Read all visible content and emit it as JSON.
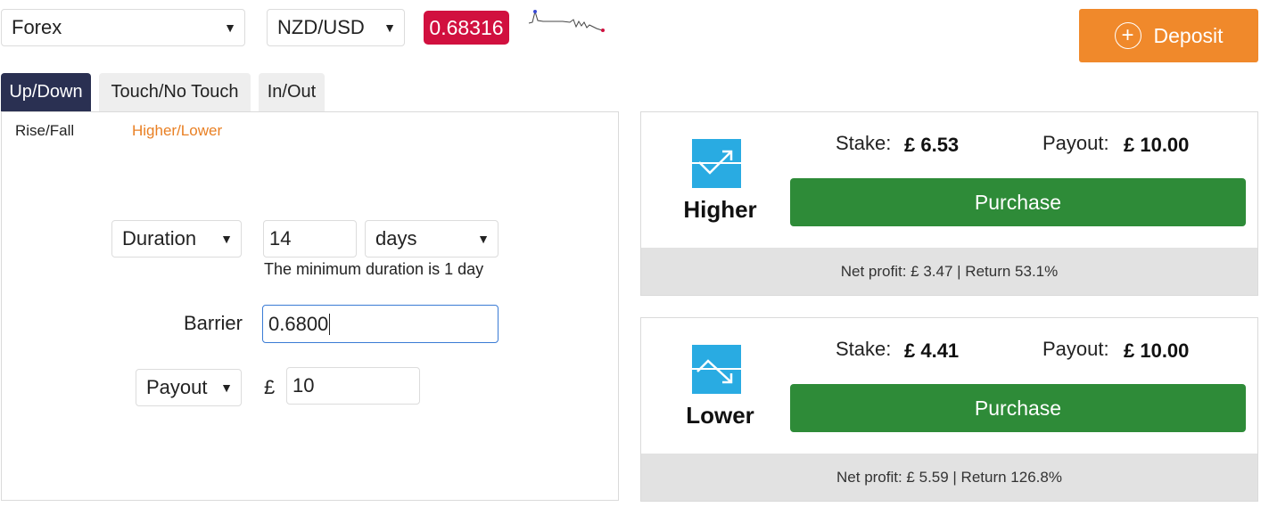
{
  "header": {
    "market_select": "Forex",
    "symbol_select": "NZD/USD",
    "spot_price": "0.68316",
    "deposit_label": "Deposit"
  },
  "tabs": [
    {
      "label": "Up/Down",
      "active": true
    },
    {
      "label": "Touch/No Touch",
      "active": false
    },
    {
      "label": "In/Out",
      "active": false
    }
  ],
  "subtabs": [
    {
      "label": "Rise/Fall",
      "active": false
    },
    {
      "label": "Higher/Lower",
      "active": true
    }
  ],
  "form": {
    "duration_type": "Duration",
    "duration_value": "14",
    "duration_unit": "days",
    "duration_hint": "The minimum duration is 1 day",
    "barrier_label": "Barrier",
    "barrier_value": "0.6800",
    "amount_type": "Payout",
    "currency_symbol": "£",
    "amount_value": "10"
  },
  "contracts": [
    {
      "type": "Higher",
      "stake_label": "Stake:",
      "stake_value": "£ 6.53",
      "payout_label": "Payout:",
      "payout_value": "£ 10.00",
      "purchase_label": "Purchase",
      "net_info": "Net profit: £ 3.47 | Return 53.1%"
    },
    {
      "type": "Lower",
      "stake_label": "Stake:",
      "stake_value": "£ 4.41",
      "payout_label": "Payout:",
      "payout_value": "£ 10.00",
      "purchase_label": "Purchase",
      "net_info": "Net profit: £ 5.59 | Return 126.8%"
    }
  ],
  "colors": {
    "active_tab": "#2a3052",
    "accent_orange": "#f0892b",
    "price_badge": "#d1103f",
    "purchase": "#2e8b38",
    "contract_icon": "#29abe2"
  }
}
